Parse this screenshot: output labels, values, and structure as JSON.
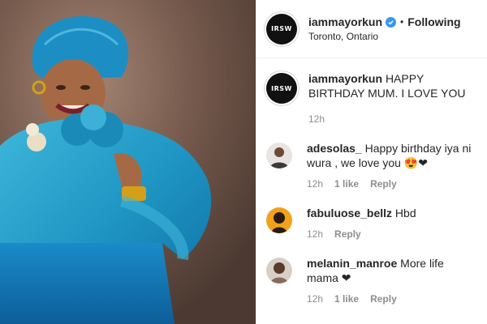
{
  "post": {
    "username": "iammayorkun",
    "follow_status": "Following",
    "location": "Toronto, Ontario",
    "avatar_text": "IRSW"
  },
  "caption": {
    "username": "iammayorkun",
    "text": "HAPPY BIRTHDAY MUM. I LOVE YOU",
    "time": "12h"
  },
  "comments": [
    {
      "username": "adesolas_",
      "text": "Happy birthday iya ni wura , we love you 😍❤",
      "time": "12h",
      "likes": "1 like",
      "reply": "Reply"
    },
    {
      "username": "fabuluose_bellz",
      "text": "Hbd",
      "time": "12h",
      "reply": "Reply"
    },
    {
      "username": "melanin_manroe",
      "text": "More life mama ❤",
      "time": "12h",
      "likes": "1 like",
      "reply": "Reply"
    }
  ],
  "icons": {
    "verified": "verified-badge-icon"
  },
  "colors": {
    "verified": "#3897f0",
    "meta_gray": "#8e8e8e",
    "text": "#262626"
  }
}
